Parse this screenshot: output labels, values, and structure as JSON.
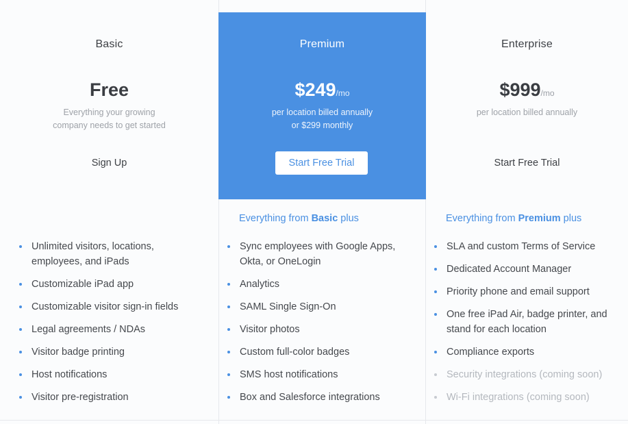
{
  "plans": {
    "basic": {
      "name": "Basic",
      "price": "Free",
      "desc_line1": "Everything your growing",
      "desc_line2": "company needs to get started",
      "cta": "Sign Up",
      "features": [
        "Unlimited visitors, locations, employees, and iPads",
        "Customizable iPad app",
        "Customizable visitor sign-in fields",
        "Legal agreements / NDAs",
        "Visitor badge printing",
        "Host notifications",
        "Visitor pre-registration"
      ]
    },
    "premium": {
      "name": "Premium",
      "price": "$249",
      "per": "/mo",
      "desc_line1": "per location billed annually",
      "desc_line2": "or $299 monthly",
      "cta": "Start Free Trial",
      "plus_prefix": "Everything from ",
      "plus_plan": "Basic",
      "plus_suffix": " plus",
      "features": [
        "Sync employees with Google Apps, Okta, or OneLogin",
        "Analytics",
        "SAML Single Sign-On",
        "Visitor photos",
        "Custom full-color badges",
        "SMS host notifications",
        "Box and Salesforce integrations"
      ]
    },
    "enterprise": {
      "name": "Enterprise",
      "price": "$999",
      "per": "/mo",
      "desc_line1": "per location billed annually",
      "cta": "Start Free Trial",
      "plus_prefix": "Everything from ",
      "plus_plan": "Premium",
      "plus_suffix": " plus",
      "features": [
        "SLA and custom Terms of Service",
        "Dedicated Account Manager",
        "Priority phone and email support",
        "One free iPad Air, badge printer, and stand for each location",
        "Compliance exports",
        "Security integrations (coming soon)",
        "Wi-Fi integrations (coming soon)"
      ]
    }
  },
  "colors": {
    "accent": "#4a90e2",
    "text": "#45484d",
    "muted": "#b4b8be"
  }
}
